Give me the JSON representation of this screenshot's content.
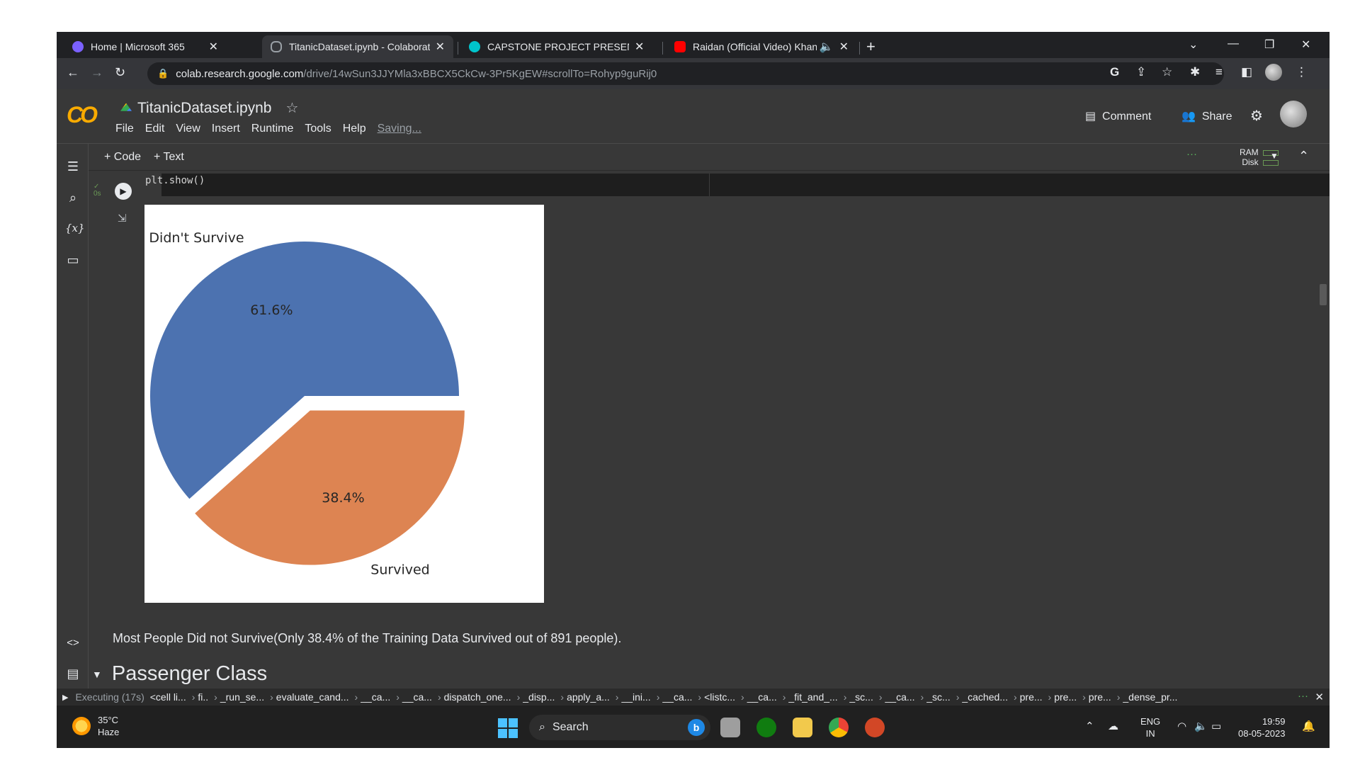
{
  "browser": {
    "tabs": [
      {
        "title": "Home | Microsoft 365",
        "icon": "microsoft-365-icon",
        "color": "#7b61ff",
        "active": false
      },
      {
        "title": "TitanicDataset.ipynb - Colaborato",
        "icon": "colab-icon",
        "color": "#9aa0a6",
        "active": true
      },
      {
        "title": "CAPSTONE PROJECT PRESENTATI",
        "icon": "canva-icon",
        "color": "#00c4cc",
        "active": false
      },
      {
        "title": "Raidan (Official Video) Khan",
        "icon": "youtube-icon",
        "color": "#ff0000",
        "active": false
      }
    ],
    "close_glyph": "✕",
    "new_tab_glyph": "+",
    "url_host": "colab.research.google.com",
    "url_path": "/drive/14wSun3JJYMla3xBBCX5CkCw-3Pr5KgEW#scrollTo=Rohyp9guRij0"
  },
  "colab": {
    "logo_text": "CO",
    "notebook_title": "TitanicDataset.ipynb",
    "menu": [
      "File",
      "Edit",
      "View",
      "Insert",
      "Runtime",
      "Tools",
      "Help"
    ],
    "saving_status": "Saving...",
    "comment_label": "Comment",
    "share_label": "Share",
    "toolbar": {
      "code_label": "+ Code",
      "text_label": "+ Text",
      "ram_label": "RAM",
      "disk_label": "Disk"
    },
    "cell": {
      "exec_time": "0s",
      "code": "plt.show()"
    },
    "markdown_text": "Most People Did not Survive(Only 38.4% of the Training Data Survived out of 891 people).",
    "section_heading": "Passenger Class",
    "status": {
      "executing": "Executing (17s)",
      "crumbs": [
        "<cell li...",
        "fi..",
        "_run_se...",
        "evaluate_cand...",
        "__ca...",
        "__ca...",
        "dispatch_one...",
        "_disp...",
        "apply_a...",
        "__ini...",
        "__ca...",
        "<listc...",
        "__ca...",
        "_fit_and_...",
        "_sc...",
        "__ca...",
        "_sc...",
        "_cached...",
        "pre...",
        "pre...",
        "pre...",
        "_dense_pr..."
      ]
    }
  },
  "chart_data": {
    "type": "pie",
    "slices": [
      {
        "label": "Didn't Survive",
        "value": 61.6,
        "data_label": "61.6%",
        "color": "#4c72b0",
        "explode": false
      },
      {
        "label": "Survived",
        "value": 38.4,
        "data_label": "38.4%",
        "color": "#dd8452",
        "explode": true
      }
    ],
    "start_angle_deg": 0,
    "direction": "counterclockwise"
  },
  "taskbar": {
    "temperature": "35°C",
    "weather": "Haze",
    "search_label": "Search",
    "lang_line1": "ENG",
    "lang_line2": "IN",
    "time": "19:59",
    "date": "08-05-2023"
  }
}
